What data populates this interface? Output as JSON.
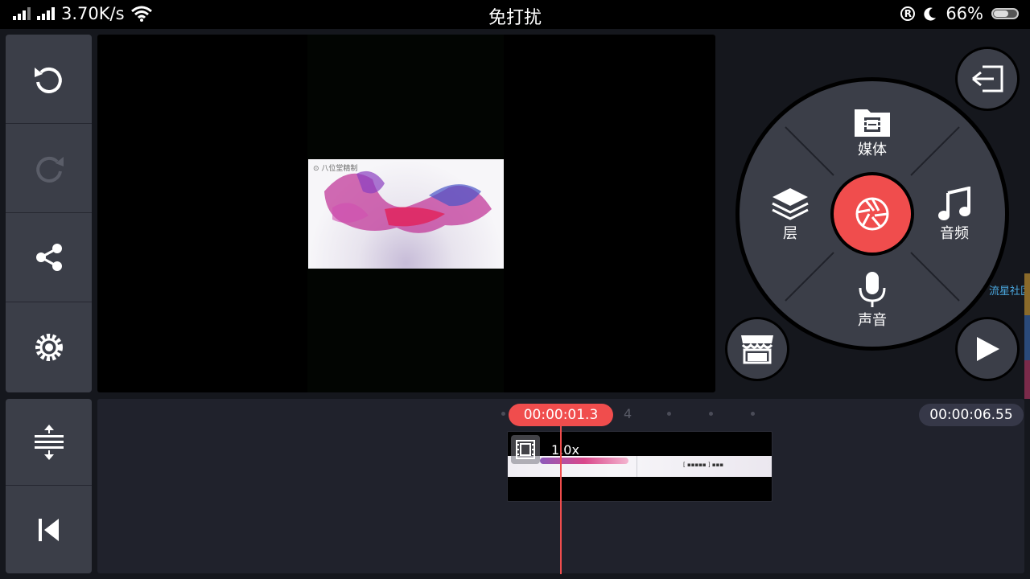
{
  "status_bar": {
    "net_speed": "3.70K/s",
    "mode_title": "免打扰",
    "battery_percent": "66%",
    "battery_level": 0.66,
    "icons": [
      "signal-icon",
      "signal-icon",
      "wifi-icon",
      "registered-icon",
      "moon-icon",
      "battery-icon"
    ]
  },
  "left_tools": {
    "top": [
      {
        "name": "undo",
        "icon": "undo-icon",
        "enabled": true
      },
      {
        "name": "redo",
        "icon": "redo-icon",
        "enabled": false
      },
      {
        "name": "share",
        "icon": "share-icon",
        "enabled": true
      },
      {
        "name": "settings",
        "icon": "gear-icon",
        "enabled": true
      }
    ],
    "bottom": [
      {
        "name": "expand-timeline",
        "icon": "expand-vertical-icon"
      },
      {
        "name": "jump-to-start",
        "icon": "skip-to-start-icon"
      }
    ]
  },
  "preview": {
    "watermark_caption": "⊙ 八位堂精制"
  },
  "main_wheel": {
    "media_label": "媒体",
    "layer_label": "层",
    "audio_label": "音频",
    "voice_label": "声音",
    "center_icon": "camera-shutter-icon",
    "accent_color": "#f04d4d"
  },
  "side_buttons": {
    "exit_icon": "exit-icon",
    "store_icon": "store-icon",
    "play_icon": "play-icon"
  },
  "edge_watermark": "流星社区",
  "timeline": {
    "current_time": "00:00:01.3",
    "total_time": "00:00:06.55",
    "ruler_number": "4",
    "clip_speed": "1.0x",
    "clip_thumb_text": "[ ▪▪▪▪▪ ] ▪▪▪"
  }
}
